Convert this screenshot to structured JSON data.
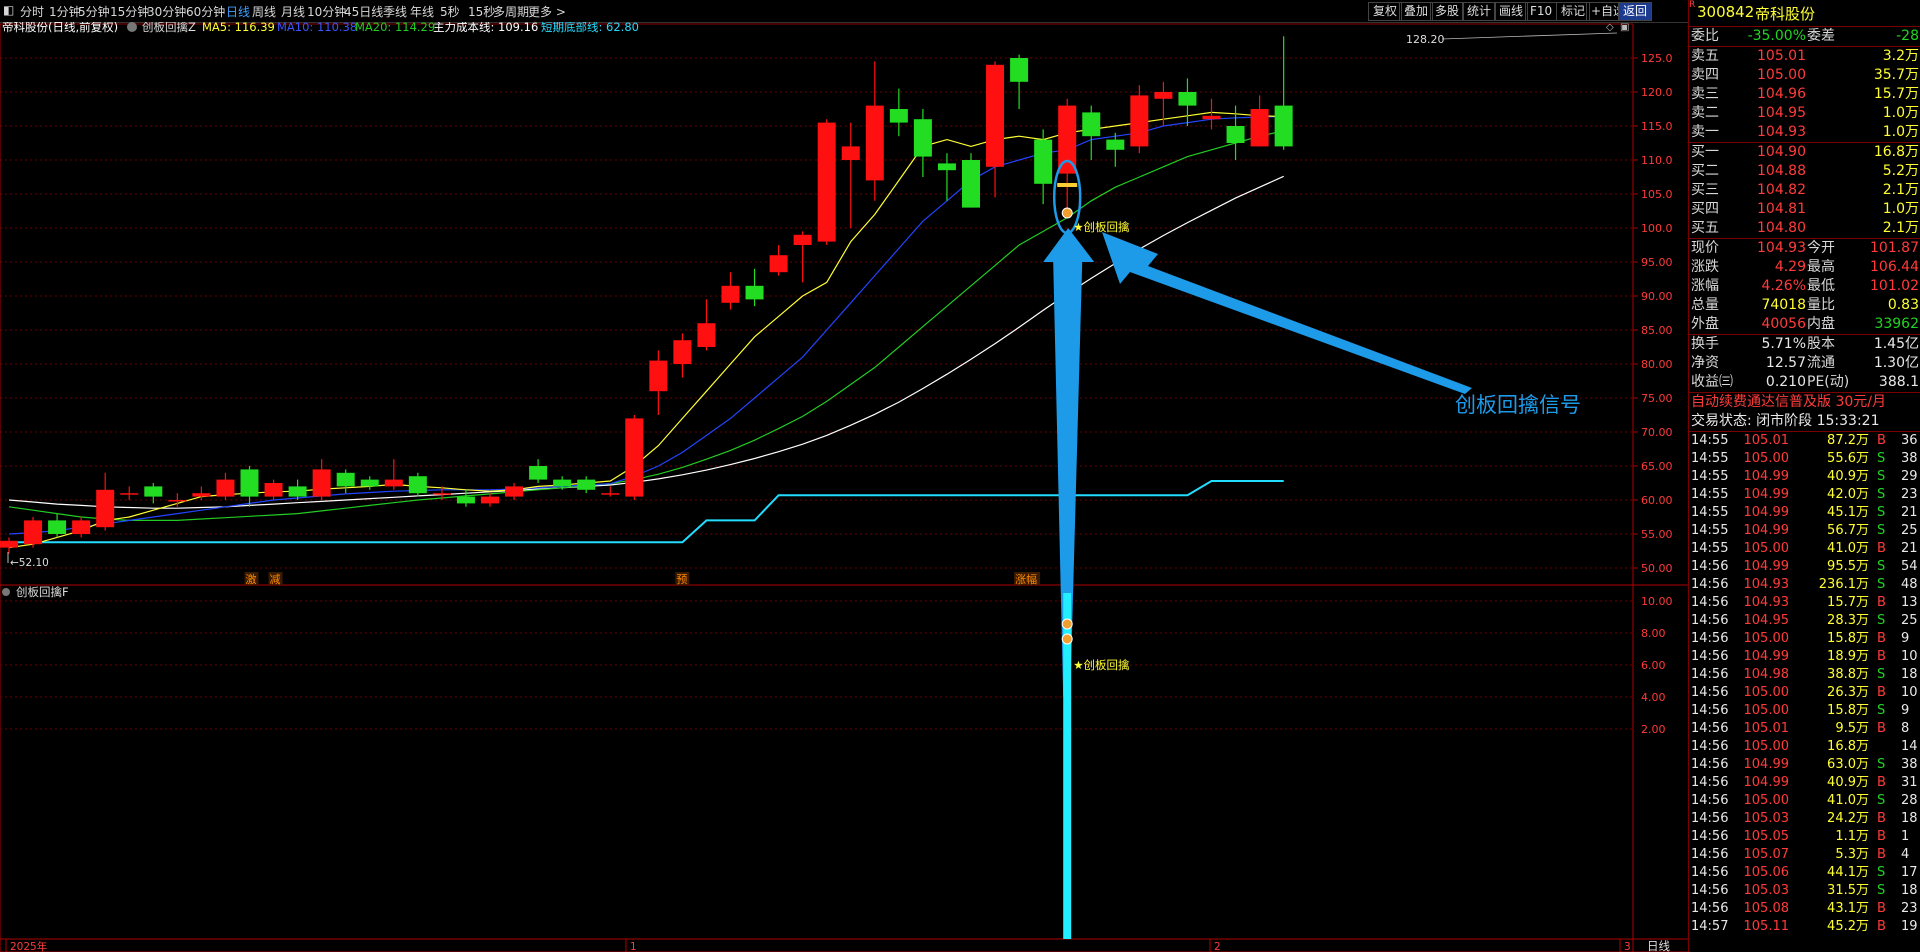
{
  "menu": {
    "items": [
      "分时",
      "1分钟",
      "5分钟",
      "15分钟",
      "30分钟",
      "60分钟",
      "日线",
      "周线",
      "月线",
      "10分钟",
      "45日线",
      "季线",
      "年线",
      "5秒",
      "15秒",
      "多周期",
      "更多 >"
    ],
    "active_index": 6,
    "right_buttons": [
      "复权",
      "叠加",
      "多股",
      "统计",
      "画线",
      "F10",
      "标记",
      "+自选",
      "返回"
    ]
  },
  "legend": {
    "prefix": "帝科股份(日线,前复权)",
    "indicator": "创板回擒Z",
    "ma5": "MA5: 116.39",
    "ma10": "MA10: 110.38",
    "ma20": "MA20: 114.29",
    "cost": "主力成本线: 109.16",
    "bottom": "短期底部线: 62.80"
  },
  "sub_panel": {
    "title": "创板回擒F",
    "signal": "★创板回擒"
  },
  "annotations": {
    "high_label": "128.20",
    "low_label": "52.10",
    "signal_label": "★创板回擒",
    "callout": "创板回擒信号",
    "marks": [
      "激",
      "减",
      "预",
      "涨幅"
    ]
  },
  "axis": {
    "main_ticks": [
      "125.0",
      "120.0",
      "115.0",
      "110.0",
      "105.0",
      "100.0",
      "95.00",
      "90.00",
      "85.00",
      "80.00",
      "75.00",
      "70.00",
      "65.00",
      "60.00",
      "55.00",
      "50.00"
    ],
    "sub_ticks": [
      "10.00",
      "8.00",
      "6.00",
      "4.00",
      "2.00"
    ],
    "x_labels": [
      "2025年",
      "1",
      "2",
      "3"
    ],
    "period_label": "日线"
  },
  "colors": {
    "up": "#ff1010",
    "down": "#22dd22",
    "ma5": "#ffff33",
    "ma10": "#2244ff",
    "ma20": "#22cc22",
    "cost": "#ffffff",
    "bottom": "#22ddff",
    "callout": "#1e9be8"
  },
  "chart_data": {
    "type": "candlestick",
    "ylim": [
      48,
      130
    ],
    "candles": [
      {
        "o": 53,
        "c": 54,
        "h": 54.5,
        "l": 52.1
      },
      {
        "o": 53.5,
        "c": 57,
        "h": 57.5,
        "l": 53
      },
      {
        "o": 57,
        "c": 55,
        "h": 58,
        "l": 54.5
      },
      {
        "o": 55,
        "c": 57,
        "h": 57.5,
        "l": 54.5
      },
      {
        "o": 56,
        "c": 61.5,
        "h": 64,
        "l": 55.5
      },
      {
        "o": 61,
        "c": 61,
        "h": 62,
        "l": 60
      },
      {
        "o": 62,
        "c": 60.5,
        "h": 62.5,
        "l": 59.5
      },
      {
        "o": 60,
        "c": 60,
        "h": 61,
        "l": 59
      },
      {
        "o": 60.5,
        "c": 61,
        "h": 62,
        "l": 60
      },
      {
        "o": 60.5,
        "c": 63,
        "h": 64,
        "l": 60
      },
      {
        "o": 64.5,
        "c": 60.5,
        "h": 65,
        "l": 59
      },
      {
        "o": 60.5,
        "c": 62.5,
        "h": 63,
        "l": 60
      },
      {
        "o": 62,
        "c": 60.5,
        "h": 63,
        "l": 60
      },
      {
        "o": 60.5,
        "c": 64.5,
        "h": 66,
        "l": 60
      },
      {
        "o": 64,
        "c": 62,
        "h": 64.5,
        "l": 61
      },
      {
        "o": 63,
        "c": 62,
        "h": 63.5,
        "l": 61.5
      },
      {
        "o": 62,
        "c": 63,
        "h": 66,
        "l": 61.5
      },
      {
        "o": 63.5,
        "c": 61,
        "h": 64,
        "l": 60.5
      },
      {
        "o": 61,
        "c": 61,
        "h": 62,
        "l": 60
      },
      {
        "o": 60.5,
        "c": 59.5,
        "h": 61.5,
        "l": 59
      },
      {
        "o": 59.5,
        "c": 60.5,
        "h": 61,
        "l": 59
      },
      {
        "o": 60.5,
        "c": 62,
        "h": 62.5,
        "l": 60
      },
      {
        "o": 65,
        "c": 63,
        "h": 66,
        "l": 62.5
      },
      {
        "o": 63,
        "c": 62,
        "h": 63.5,
        "l": 61.5
      },
      {
        "o": 63,
        "c": 61.5,
        "h": 63.5,
        "l": 61
      },
      {
        "o": 61,
        "c": 61,
        "h": 62,
        "l": 60.5
      },
      {
        "o": 60.5,
        "c": 72,
        "h": 72.5,
        "l": 60
      },
      {
        "o": 76,
        "c": 80.5,
        "h": 82,
        "l": 72.5
      },
      {
        "o": 80,
        "c": 83.5,
        "h": 84.5,
        "l": 78
      },
      {
        "o": 82.5,
        "c": 86,
        "h": 89.5,
        "l": 82
      },
      {
        "o": 89,
        "c": 91.5,
        "h": 93.5,
        "l": 88
      },
      {
        "o": 91.5,
        "c": 89.5,
        "h": 94,
        "l": 88.5
      },
      {
        "o": 93.5,
        "c": 96,
        "h": 97.5,
        "l": 93
      },
      {
        "o": 97.5,
        "c": 99,
        "h": 99.5,
        "l": 92
      },
      {
        "o": 98,
        "c": 115.5,
        "h": 116,
        "l": 97.5
      },
      {
        "o": 110,
        "c": 112,
        "h": 115.5,
        "l": 100
      },
      {
        "o": 107,
        "c": 118,
        "h": 124.5,
        "l": 104
      },
      {
        "o": 117.5,
        "c": 115.5,
        "h": 120.5,
        "l": 113.5
      },
      {
        "o": 116,
        "c": 110.5,
        "h": 117.5,
        "l": 107.5
      },
      {
        "o": 109.5,
        "c": 108.5,
        "h": 111,
        "l": 104
      },
      {
        "o": 110,
        "c": 103,
        "h": 111,
        "l": 103
      },
      {
        "o": 109,
        "c": 124,
        "h": 124.5,
        "l": 104.5
      },
      {
        "o": 125,
        "c": 121.5,
        "h": 125.5,
        "l": 117.5
      },
      {
        "o": 113,
        "c": 106.5,
        "h": 114.5,
        "l": 103.5
      },
      {
        "o": 108,
        "c": 118,
        "h": 119,
        "l": 102.5
      },
      {
        "o": 117,
        "c": 113.5,
        "h": 118,
        "l": 110
      },
      {
        "o": 113,
        "c": 111.5,
        "h": 114,
        "l": 109
      },
      {
        "o": 112,
        "c": 119.5,
        "h": 121,
        "l": 111
      },
      {
        "o": 119,
        "c": 120,
        "h": 121.5,
        "l": 115
      },
      {
        "o": 120,
        "c": 118,
        "h": 122,
        "l": 115
      },
      {
        "o": 116,
        "c": 116.5,
        "h": 119,
        "l": 114.5
      },
      {
        "o": 115,
        "c": 112.5,
        "h": 118,
        "l": 110
      },
      {
        "o": 112,
        "c": 117.5,
        "h": 119.5,
        "l": 112
      },
      {
        "o": 118,
        "c": 112,
        "h": 128.2,
        "l": 111.5
      }
    ],
    "ma5": [
      53,
      53.5,
      54.5,
      55.5,
      57,
      57.5,
      58.5,
      59.5,
      60.5,
      60.8,
      61,
      61.2,
      61.3,
      61.6,
      61.8,
      62,
      62.3,
      62,
      61.8,
      61.5,
      61.3,
      61.5,
      62,
      62.2,
      62.5,
      62.8,
      65,
      68,
      72,
      76,
      80,
      84,
      87,
      90,
      92,
      98,
      102,
      107,
      112,
      113,
      112,
      113,
      113.5,
      113,
      114,
      114.5,
      115,
      115.5,
      116,
      116.5,
      117,
      116.8,
      116.5,
      116.4
    ],
    "ma10": [
      55,
      55.2,
      55.5,
      56,
      56.5,
      57,
      57.5,
      58,
      58.5,
      59,
      59.5,
      60,
      60.3,
      60.6,
      60.9,
      61.1,
      61.3,
      61.4,
      61.5,
      61.5,
      61.5,
      61.6,
      61.8,
      62,
      62.2,
      62.4,
      63.5,
      65,
      67,
      69.5,
      72,
      75,
      78,
      81,
      85,
      89,
      93,
      97,
      101,
      104,
      107,
      109,
      110,
      111,
      111.5,
      113,
      113.5,
      114,
      115,
      115.5,
      116,
      116.2,
      116.3,
      116.4
    ],
    "ma20": [
      59,
      58.5,
      58,
      57.5,
      57.2,
      57,
      57,
      57,
      57.2,
      57.4,
      57.6,
      57.8,
      58,
      58.4,
      58.8,
      59.2,
      59.6,
      60,
      60.3,
      60.6,
      60.9,
      61.2,
      61.5,
      61.8,
      62.1,
      62.4,
      63,
      63.8,
      64.8,
      66,
      67.3,
      68.8,
      70.5,
      72.3,
      74.5,
      77,
      79.5,
      82.5,
      85.5,
      88.5,
      91.5,
      94.5,
      97.5,
      99.5,
      101.5,
      104,
      106,
      107.5,
      109,
      110.5,
      111.5,
      112.5,
      113.5,
      114.3
    ],
    "cost": [
      60,
      59.7,
      59.4,
      59.2,
      59,
      58.9,
      58.8,
      58.8,
      58.9,
      59,
      59.2,
      59.4,
      59.6,
      59.8,
      60,
      60.2,
      60.4,
      60.6,
      60.8,
      61,
      61.2,
      61.4,
      61.6,
      61.8,
      62,
      62.2,
      62.6,
      63.1,
      63.7,
      64.4,
      65.2,
      66.1,
      67.1,
      68.2,
      69.5,
      71,
      72.6,
      74.4,
      76.4,
      78.5,
      80.7,
      83,
      85.4,
      87.9,
      90.3,
      92.6,
      94.8,
      96.9,
      98.9,
      100.8,
      102.6,
      104.4,
      106,
      107.6
    ],
    "bottom_line": [
      53.8,
      53.8,
      53.8,
      53.8,
      53.8,
      53.8,
      53.8,
      53.8,
      53.8,
      53.8,
      53.8,
      53.8,
      53.8,
      53.8,
      53.8,
      53.8,
      53.8,
      53.8,
      53.8,
      53.8,
      53.8,
      53.8,
      53.8,
      53.8,
      53.8,
      53.8,
      53.8,
      53.8,
      53.8,
      57,
      57,
      57,
      60.7,
      60.7,
      60.7,
      60.7,
      60.7,
      60.7,
      60.7,
      60.7,
      60.7,
      60.7,
      60.7,
      60.7,
      60.7,
      60.7,
      60.7,
      60.7,
      60.7,
      60.7,
      62.8,
      62.8,
      62.8,
      62.8
    ],
    "signal_index": 44,
    "sub_ylim": [
      0,
      11
    ],
    "sub_bar_value": 10.5
  },
  "right": {
    "code": "300842",
    "name": "帝科股份",
    "weibi": {
      "label": "委比",
      "value": "-35.00%",
      "label2": "委差",
      "value2": "-28"
    },
    "sell": [
      {
        "label": "卖五",
        "price": "105.01",
        "vol": "3.2万"
      },
      {
        "label": "卖四",
        "price": "105.00",
        "vol": "35.7万"
      },
      {
        "label": "卖三",
        "price": "104.96",
        "vol": "15.7万"
      },
      {
        "label": "卖二",
        "price": "104.95",
        "vol": "1.0万"
      },
      {
        "label": "卖一",
        "price": "104.93",
        "vol": "1.0万"
      }
    ],
    "buy": [
      {
        "label": "买一",
        "price": "104.90",
        "vol": "16.8万"
      },
      {
        "label": "买二",
        "price": "104.88",
        "vol": "5.2万"
      },
      {
        "label": "买三",
        "price": "104.82",
        "vol": "2.1万"
      },
      {
        "label": "买四",
        "price": "104.81",
        "vol": "1.0万"
      },
      {
        "label": "买五",
        "price": "104.80",
        "vol": "2.1万"
      }
    ],
    "quote": [
      {
        "l1": "现价",
        "v1": "104.93",
        "l2": "今开",
        "v2": "101.87"
      },
      {
        "l1": "涨跌",
        "v1": "4.29",
        "l2": "最高",
        "v2": "106.44"
      },
      {
        "l1": "涨幅",
        "v1": "4.26%",
        "l2": "最低",
        "v2": "101.02"
      },
      {
        "l1": "总量",
        "v1": "74018",
        "l2": "量比",
        "v2": "0.83"
      },
      {
        "l1": "外盘",
        "v1": "40056",
        "l2": "内盘",
        "v2": "33962"
      }
    ],
    "fin": [
      {
        "l1": "换手",
        "v1": "5.71%",
        "l2": "股本",
        "v2": "1.45亿"
      },
      {
        "l1": "净资",
        "v1": "12.57",
        "l2": "流通",
        "v2": "1.30亿"
      },
      {
        "l1": "收益㈢",
        "v1": "0.210",
        "l2": "PE(动)",
        "v2": "388.1"
      }
    ],
    "promo": "自动续费通达信普及版  30元/月",
    "status": "交易状态: 闭市阶段 15:33:21",
    "ticks": [
      [
        "14:55",
        "105.01",
        "87.2万",
        "B",
        "36"
      ],
      [
        "14:55",
        "105.00",
        "55.6万",
        "S",
        "38"
      ],
      [
        "14:55",
        "104.99",
        "40.9万",
        "S",
        "29"
      ],
      [
        "14:55",
        "104.99",
        "42.0万",
        "S",
        "23"
      ],
      [
        "14:55",
        "104.99",
        "45.1万",
        "S",
        "21"
      ],
      [
        "14:55",
        "104.99",
        "56.7万",
        "S",
        "25"
      ],
      [
        "14:55",
        "105.00",
        "41.0万",
        "B",
        "21"
      ],
      [
        "14:56",
        "104.99",
        "95.5万",
        "S",
        "54"
      ],
      [
        "14:56",
        "104.93",
        "236.1万",
        "S",
        "48"
      ],
      [
        "14:56",
        "104.93",
        "15.7万",
        "B",
        "13"
      ],
      [
        "14:56",
        "104.95",
        "28.3万",
        "S",
        "25"
      ],
      [
        "14:56",
        "105.00",
        "15.8万",
        "B",
        "9"
      ],
      [
        "14:56",
        "104.99",
        "18.9万",
        "B",
        "10"
      ],
      [
        "14:56",
        "104.98",
        "38.8万",
        "S",
        "18"
      ],
      [
        "14:56",
        "105.00",
        "26.3万",
        "B",
        "10"
      ],
      [
        "14:56",
        "105.00",
        "15.8万",
        "S",
        "9"
      ],
      [
        "14:56",
        "105.01",
        "9.5万",
        "B",
        "8"
      ],
      [
        "14:56",
        "105.00",
        "16.8万",
        "",
        "14"
      ],
      [
        "14:56",
        "104.99",
        "63.0万",
        "S",
        "38"
      ],
      [
        "14:56",
        "104.99",
        "40.9万",
        "B",
        "31"
      ],
      [
        "14:56",
        "105.00",
        "41.0万",
        "S",
        "28"
      ],
      [
        "14:56",
        "105.03",
        "24.2万",
        "B",
        "18"
      ],
      [
        "14:56",
        "105.05",
        "1.1万",
        "B",
        "1"
      ],
      [
        "14:56",
        "105.07",
        "5.3万",
        "B",
        "4"
      ],
      [
        "14:56",
        "105.06",
        "44.1万",
        "S",
        "17"
      ],
      [
        "14:56",
        "105.03",
        "31.5万",
        "S",
        "18"
      ],
      [
        "14:56",
        "105.08",
        "43.1万",
        "B",
        "23"
      ],
      [
        "14:57",
        "105.11",
        "45.2万",
        "B",
        "19"
      ]
    ]
  }
}
